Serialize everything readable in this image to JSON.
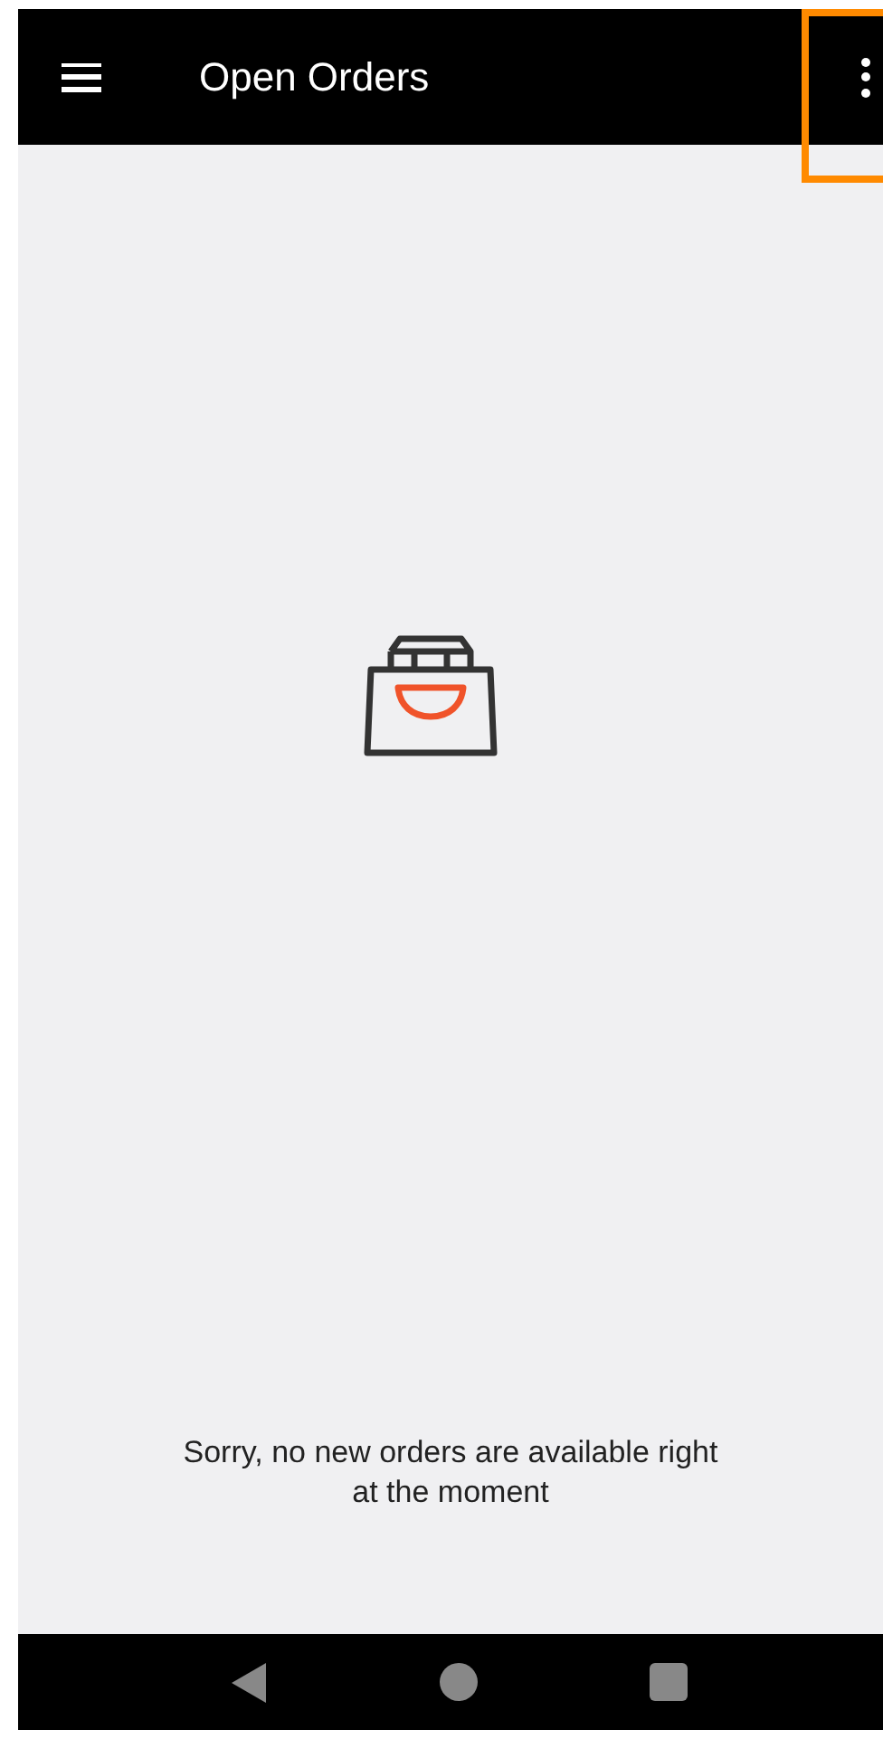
{
  "app_bar": {
    "title": "Open Orders",
    "overflow_menu": {
      "highlighted": true
    }
  },
  "empty_state": {
    "message": "Sorry, no new orders are available right at the moment"
  }
}
